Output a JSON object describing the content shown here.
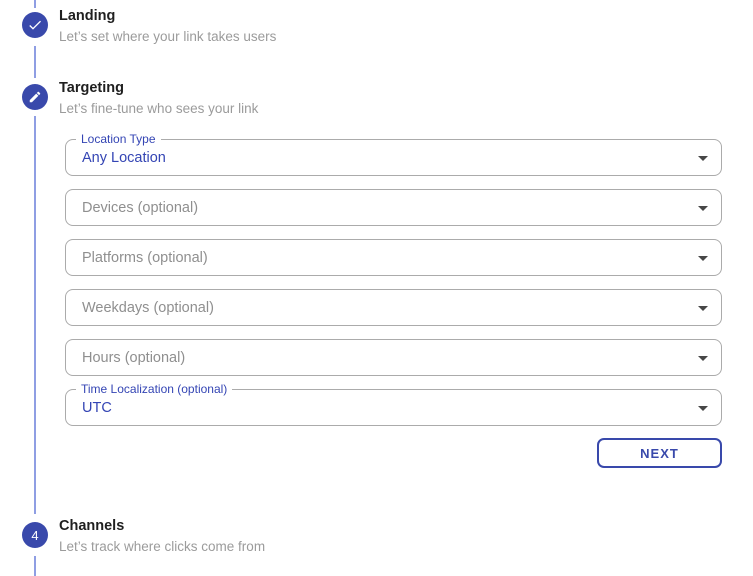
{
  "colors": {
    "accent_indigo": "#3949ab",
    "field_text_blue": "#3445b4",
    "connector_line": "#8f9ee3",
    "field_border": "#ababab",
    "placeholder_gray": "#8f8f8f",
    "subtitle_gray": "#9b9b9b",
    "title_dark": "#1f1f1f",
    "arrow_dark": "#474747"
  },
  "stepper": {
    "steps": [
      {
        "id": "landing",
        "title": "Landing",
        "subtitle": "Let’s set where your link takes users",
        "icon": "check-icon",
        "state": "completed"
      },
      {
        "id": "targeting",
        "title": "Targeting",
        "subtitle": "Let’s fine-tune who sees your link",
        "icon": "edit-icon",
        "state": "active"
      },
      {
        "id": "channels",
        "title": "Channels",
        "subtitle": "Let’s track where clicks come from",
        "number": "4",
        "state": "upcoming"
      }
    ]
  },
  "form": {
    "fields": [
      {
        "label": "Location Type",
        "value": "Any Location"
      },
      {
        "placeholder": "Devices (optional)"
      },
      {
        "placeholder": "Platforms (optional)"
      },
      {
        "placeholder": "Weekdays (optional)"
      },
      {
        "placeholder": "Hours (optional)"
      },
      {
        "label": "Time Localization (optional)",
        "value": "UTC"
      }
    ],
    "next_button_label": "NEXT"
  }
}
